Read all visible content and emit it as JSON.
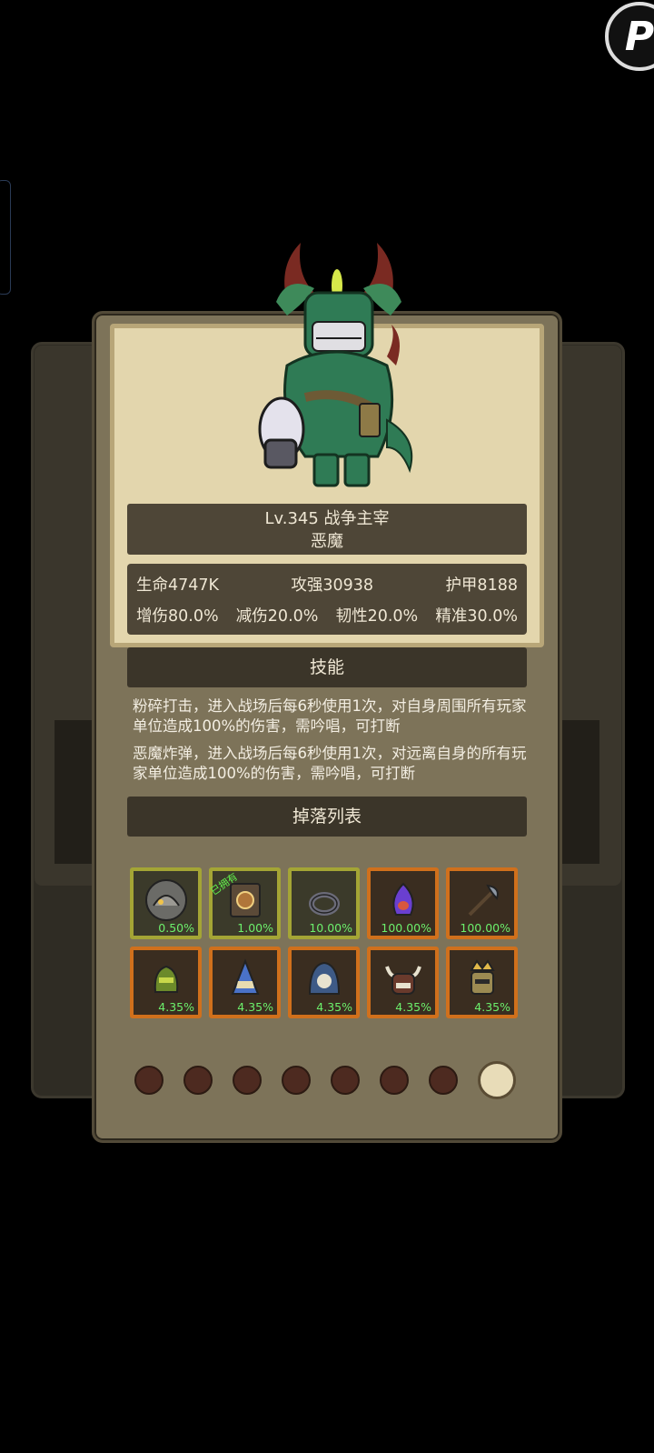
{
  "corner_logo": "P",
  "monster": {
    "title_line": "Lv.345 战争主宰",
    "race": "恶魔"
  },
  "stats": {
    "row1": [
      "生命4747K",
      "攻强30938",
      "护甲8188"
    ],
    "row2": [
      "增伤80.0%",
      "减伤20.0%",
      "韧性20.0%",
      "精准30.0%"
    ]
  },
  "skills": {
    "header": "技能",
    "items": [
      "粉碎打击，进入战场后每6秒使用1次，对自身周围所有玩家单位造成100%的伤害，需吟唱，可打断",
      "恶魔炸弹，进入战场后每6秒使用1次，对远离自身的所有玩家单位造成100%的伤害，需吟唱，可打断"
    ]
  },
  "drops": {
    "header": "掉落列表",
    "owned_label": "已拥有",
    "items": [
      {
        "icon": "rock-beast-icon",
        "rate": "0.50%",
        "rarity": "green"
      },
      {
        "icon": "rune-tablet-icon",
        "rate": "1.00%",
        "rarity": "green",
        "owned": true
      },
      {
        "icon": "ring-icon",
        "rate": "10.00%",
        "rarity": "green"
      },
      {
        "icon": "purple-gem-icon",
        "rate": "100.00%",
        "rarity": "orange"
      },
      {
        "icon": "battle-axe-icon",
        "rate": "100.00%",
        "rarity": "orange"
      },
      {
        "icon": "green-helmet-icon",
        "rate": "4.35%",
        "rarity": "orange"
      },
      {
        "icon": "wizard-hat-icon",
        "rate": "4.35%",
        "rarity": "orange"
      },
      {
        "icon": "skull-hood-icon",
        "rate": "4.35%",
        "rarity": "orange"
      },
      {
        "icon": "horned-helmet-icon",
        "rate": "4.35%",
        "rarity": "orange"
      },
      {
        "icon": "crowned-helmet-icon",
        "rate": "4.35%",
        "rarity": "orange"
      }
    ]
  },
  "pagination": {
    "count": 8,
    "active_index": 7
  },
  "colors": {
    "card": "#7d7359",
    "portrait": "#e3d6ad",
    "bar": "#4e4637",
    "green_frame": "#a4a535",
    "orange_frame": "#d0701c",
    "rate_text": "#6cf06c"
  }
}
